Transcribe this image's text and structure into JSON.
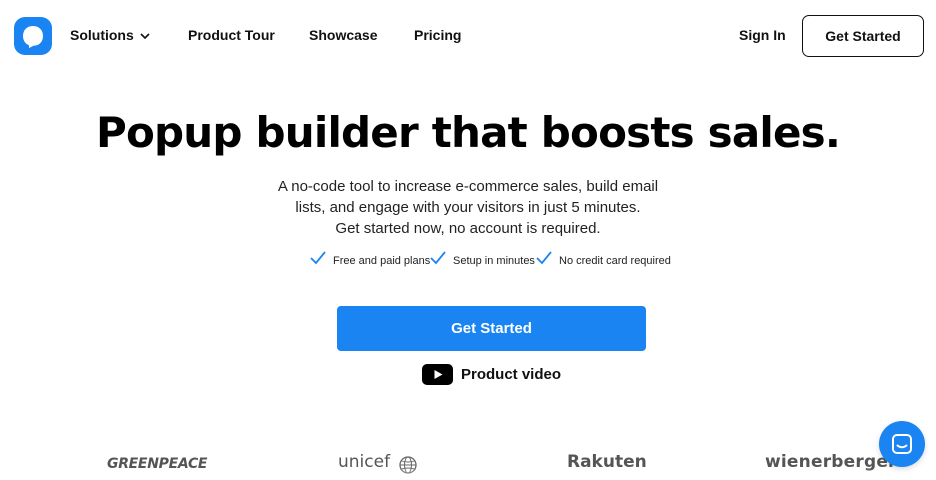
{
  "brand": {
    "logo_icon": "popupsmart-logo-icon",
    "accent_color": "#1a84f2"
  },
  "nav": {
    "solutions": "Solutions",
    "product_tour": "Product Tour",
    "showcase": "Showcase",
    "pricing": "Pricing",
    "sign_in": "Sign In",
    "get_started": "Get Started"
  },
  "hero": {
    "title": "Popup builder that boosts sales.",
    "subtitle_lines": [
      "A no-code tool to increase e-commerce sales, build email",
      "lists, and engage with your visitors in just 5 minutes.",
      "Get started now, no account is required."
    ],
    "features": [
      "Free and paid plans",
      "Setup in minutes",
      "No credit card required"
    ],
    "cta_label": "Get Started",
    "video_label": "Product video"
  },
  "logos": [
    "GREENPEACE",
    "unicef",
    "Rakuten",
    "wienerberger"
  ],
  "chat": {
    "icon": "chat-icon"
  }
}
